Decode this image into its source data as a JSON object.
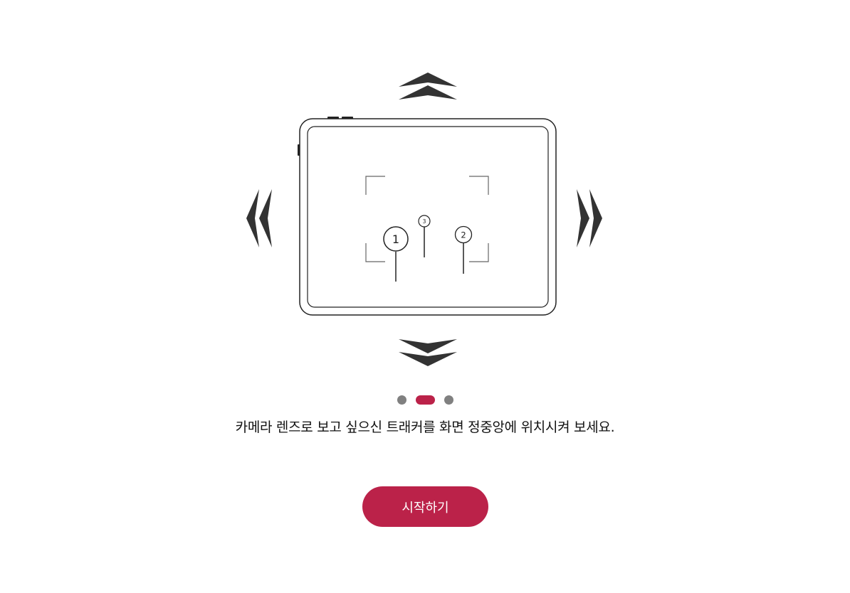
{
  "illustration": {
    "marker_labels": [
      "1",
      "2",
      "3"
    ]
  },
  "pager": {
    "count": 3,
    "active_index": 1
  },
  "instruction": "카메라 렌즈로 보고 싶으신 트래커를 화면 정중앙에 위치시켜 보세요.",
  "start_button": {
    "label": "시작하기"
  },
  "colors": {
    "accent": "#bb2249",
    "arrow": "#333333",
    "dot_inactive": "#808080"
  },
  "icons": [
    "chevron-double-up-icon",
    "chevron-double-down-icon",
    "chevron-double-left-icon",
    "chevron-double-right-icon",
    "tablet-icon"
  ]
}
